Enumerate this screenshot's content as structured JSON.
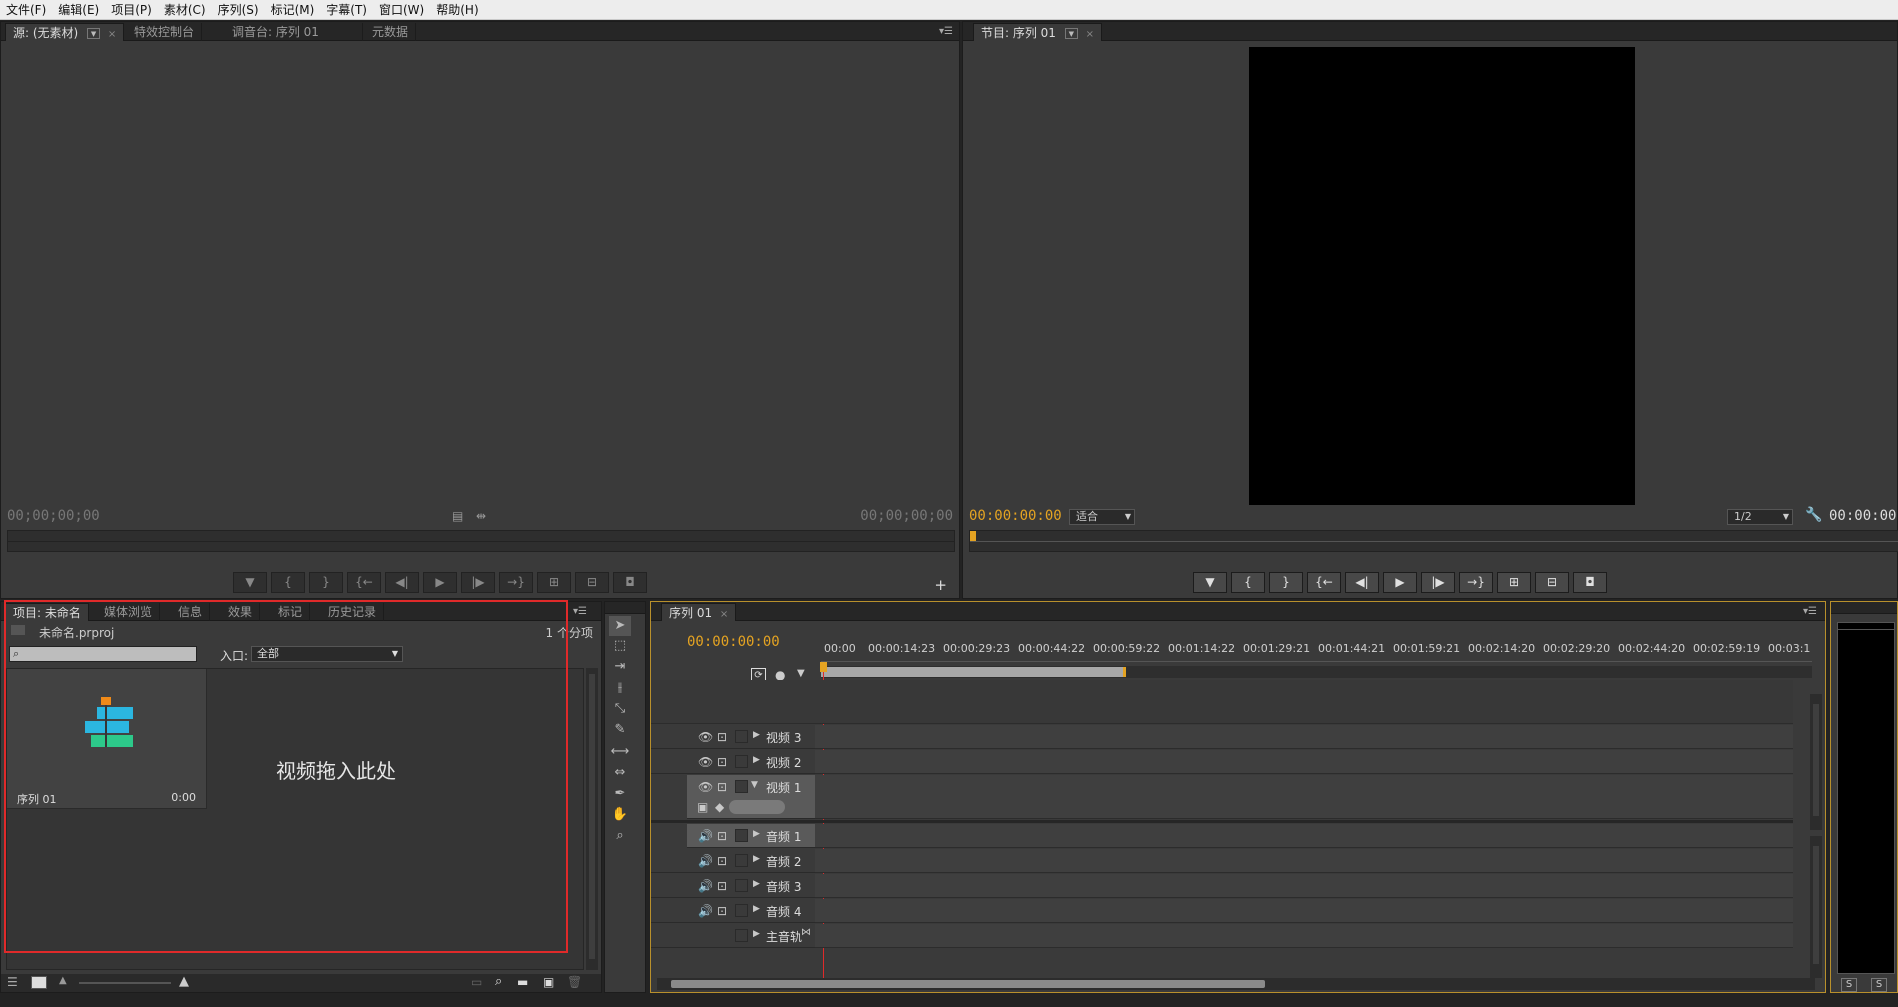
{
  "menu": [
    "文件(F)",
    "编辑(E)",
    "项目(P)",
    "素材(C)",
    "序列(S)",
    "标记(M)",
    "字幕(T)",
    "窗口(W)",
    "帮助(H)"
  ],
  "source_panel": {
    "tabs": [
      "源: (无素材)",
      "特效控制台",
      "调音台: 序列 01",
      "元数据"
    ],
    "timecode_left": "00;00;00;00",
    "timecode_right": "00;00;00;00"
  },
  "program_panel": {
    "tab": "节目: 序列 01",
    "timecode": "00:00:00:00",
    "fit": "适合",
    "resolution": "1/2",
    "timecode_right": "00:00:00:0"
  },
  "project_panel": {
    "tabs": [
      "项目: 未命名",
      "媒体浏览",
      "信息",
      "效果",
      "标记",
      "历史记录"
    ],
    "project_file": "未命名.prproj",
    "item_count": "1 个分项",
    "search_value": "",
    "entry_label": "入口:",
    "entry_value": "全部",
    "item_name": "序列 01",
    "item_duration": "0:00",
    "annotation": "视频拖入此处"
  },
  "timeline_panel": {
    "tab": "序列 01",
    "timecode": "00:00:00:00",
    "ruler": [
      "00:00",
      "00:00:14:23",
      "00:00:29:23",
      "00:00:44:22",
      "00:00:59:22",
      "00:01:14:22",
      "00:01:29:21",
      "00:01:44:21",
      "00:01:59:21",
      "00:02:14:20",
      "00:02:29:20",
      "00:02:44:20",
      "00:02:59:19",
      "00:03:1"
    ],
    "video_tracks": [
      "视频 3",
      "视频 2",
      "视频 1"
    ],
    "audio_tracks": [
      "音频 1",
      "音频 2",
      "音频 3",
      "音频 4"
    ],
    "master_track": "主音轨"
  },
  "audio_meter": {
    "solo_left": "S",
    "solo_right": "S"
  },
  "colors": {
    "accent_timecode": "#e4a322",
    "highlight_box": "#e02a2a"
  }
}
